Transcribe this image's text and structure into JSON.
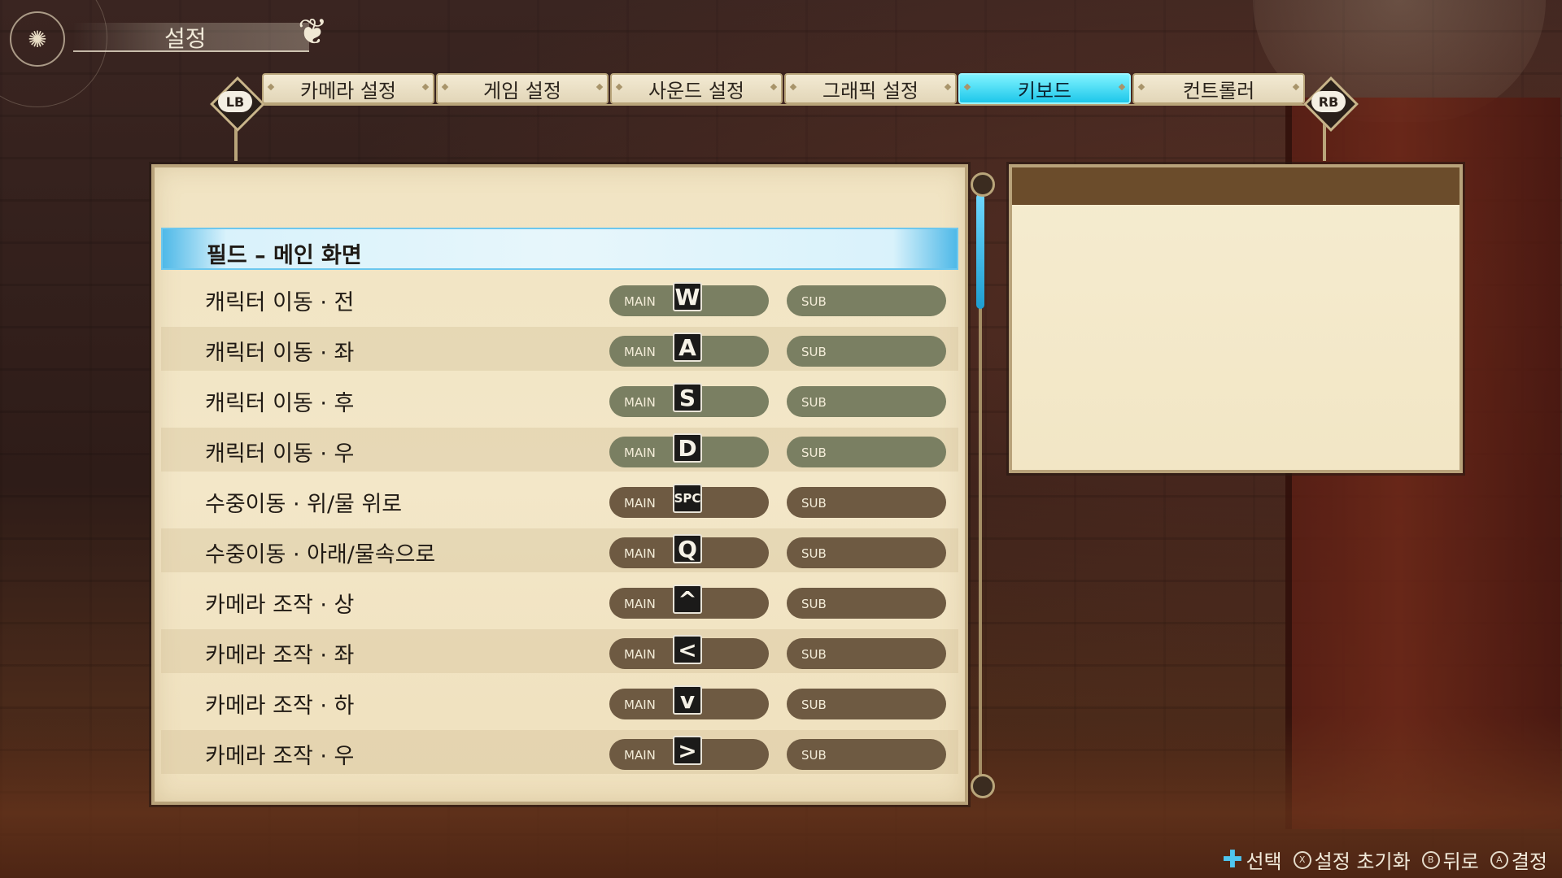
{
  "header": {
    "title": "설정"
  },
  "tabs": {
    "lb_label": "LB",
    "rb_label": "RB",
    "items": [
      {
        "label": "카메라 설정",
        "active": false
      },
      {
        "label": "게임 설정",
        "active": false
      },
      {
        "label": "사운드 설정",
        "active": false
      },
      {
        "label": "그래픽 설정",
        "active": false
      },
      {
        "label": "키보드",
        "active": true
      },
      {
        "label": "컨트롤러",
        "active": false
      }
    ]
  },
  "bindings": {
    "section": "필드 – 메인 화면",
    "main_tag": "MAIN",
    "sub_tag": "SUB",
    "rows": [
      {
        "label": "캐릭터 이동 · 전",
        "key": "W"
      },
      {
        "label": "캐릭터 이동 · 좌",
        "key": "A"
      },
      {
        "label": "캐릭터 이동 · 후",
        "key": "S"
      },
      {
        "label": "캐릭터 이동 · 우",
        "key": "D"
      },
      {
        "label": "수중이동 · 위/물 위로",
        "key": "SPC"
      },
      {
        "label": "수중이동 · 아래/물속으로",
        "key": "Q"
      },
      {
        "label": "카메라 조작 · 상",
        "key": "^"
      },
      {
        "label": "카메라 조작 · 좌",
        "key": "<"
      },
      {
        "label": "카메라 조작 · 하",
        "key": "v"
      },
      {
        "label": "카메라 조작 · 우",
        "key": ">"
      }
    ]
  },
  "footer": {
    "select": "선택",
    "reset": "설정 초기화",
    "back": "뒤로",
    "confirm": "결정",
    "x_btn": "X",
    "b_btn": "B",
    "a_btn": "A"
  },
  "colors": {
    "accent_cyan": "#1ec7ea",
    "pill_green": "#7a7f62",
    "pill_brown": "#6e5a42",
    "panel_parchment": "#f1e4c3"
  }
}
